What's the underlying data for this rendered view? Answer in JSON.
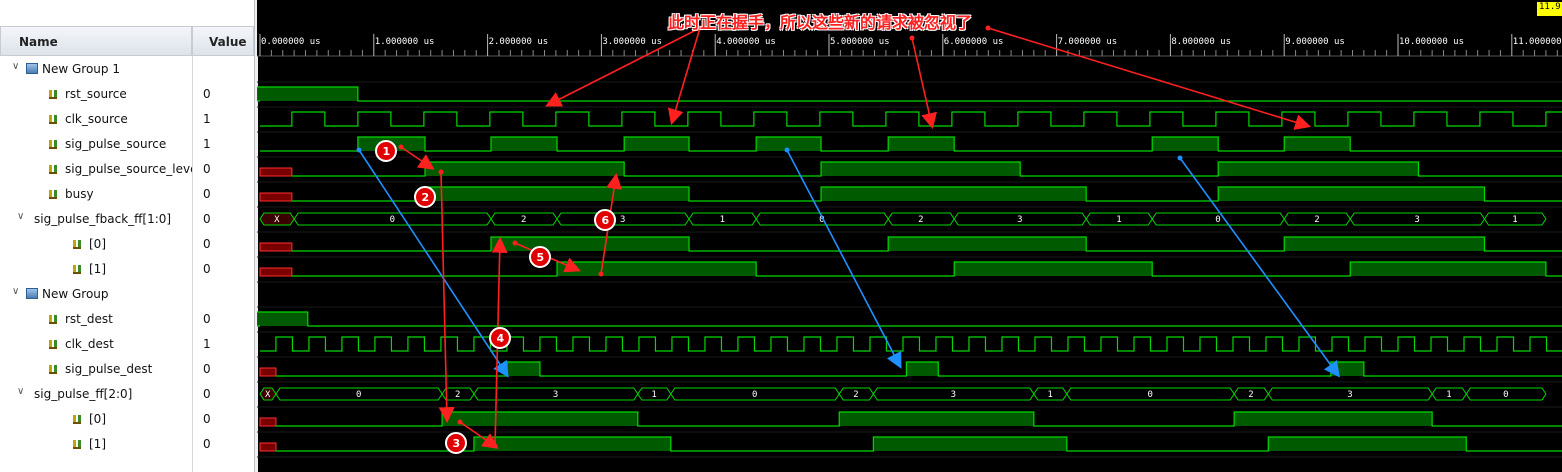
{
  "header": {
    "name_col": "Name",
    "value_col": "Value"
  },
  "signals": [
    {
      "name": "New Group 1",
      "value": "",
      "kind": "group",
      "indent": 0
    },
    {
      "name": "rst_source",
      "value": "0",
      "kind": "bit",
      "indent": 2
    },
    {
      "name": "clk_source",
      "value": "1",
      "kind": "bit",
      "indent": 2
    },
    {
      "name": "sig_pulse_source",
      "value": "1",
      "kind": "bit",
      "indent": 2
    },
    {
      "name": "sig_pulse_source_level",
      "value": "0",
      "kind": "bit",
      "indent": 2
    },
    {
      "name": "busy",
      "value": "0",
      "kind": "bit",
      "indent": 2
    },
    {
      "name": "sig_pulse_fback_ff[1:0]",
      "value": "0",
      "kind": "bus",
      "indent": 1
    },
    {
      "name": "[0]",
      "value": "0",
      "kind": "bit",
      "indent": 3
    },
    {
      "name": "[1]",
      "value": "0",
      "kind": "bit",
      "indent": 3
    },
    {
      "name": "New Group",
      "value": "",
      "kind": "group",
      "indent": 0
    },
    {
      "name": "rst_dest",
      "value": "0",
      "kind": "bit",
      "indent": 2
    },
    {
      "name": "clk_dest",
      "value": "1",
      "kind": "bit",
      "indent": 2
    },
    {
      "name": "sig_pulse_dest",
      "value": "0",
      "kind": "bit",
      "indent": 2
    },
    {
      "name": "sig_pulse_ff[2:0]",
      "value": "0",
      "kind": "bus",
      "indent": 1
    },
    {
      "name": "[0]",
      "value": "0",
      "kind": "bit",
      "indent": 3
    },
    {
      "name": "[1]",
      "value": "0",
      "kind": "bit",
      "indent": 3
    }
  ],
  "timeline": {
    "ticks": [
      "0.000000 us",
      "1.000000 us",
      "2.000000 us",
      "3.000000 us",
      "4.000000 us",
      "5.000000 us",
      "6.000000 us",
      "7.000000 us",
      "8.000000 us",
      "9.000000 us",
      "10.000000 us",
      "11.000000"
    ],
    "cursor_label": "11.9"
  },
  "bus_labels": {
    "fback": [
      "X",
      "0",
      "2",
      "3",
      "1",
      "0",
      "2",
      "3",
      "1",
      "0",
      "2",
      "3",
      "1"
    ],
    "ff": [
      "X",
      "0",
      "2",
      "3",
      "1",
      "0",
      "2",
      "3",
      "1",
      "0",
      "2",
      "3",
      "1",
      "0"
    ]
  },
  "annotation": {
    "note": "此时正在握手，所以这些新的请求被忽视了",
    "markers": [
      "1",
      "2",
      "3",
      "4",
      "5",
      "6"
    ]
  },
  "colors": {
    "wave": "#00d800",
    "fill": "#005a00",
    "arrow_red": "#ff2020",
    "arrow_blue": "#1e90ff",
    "marker": "#e00000"
  }
}
